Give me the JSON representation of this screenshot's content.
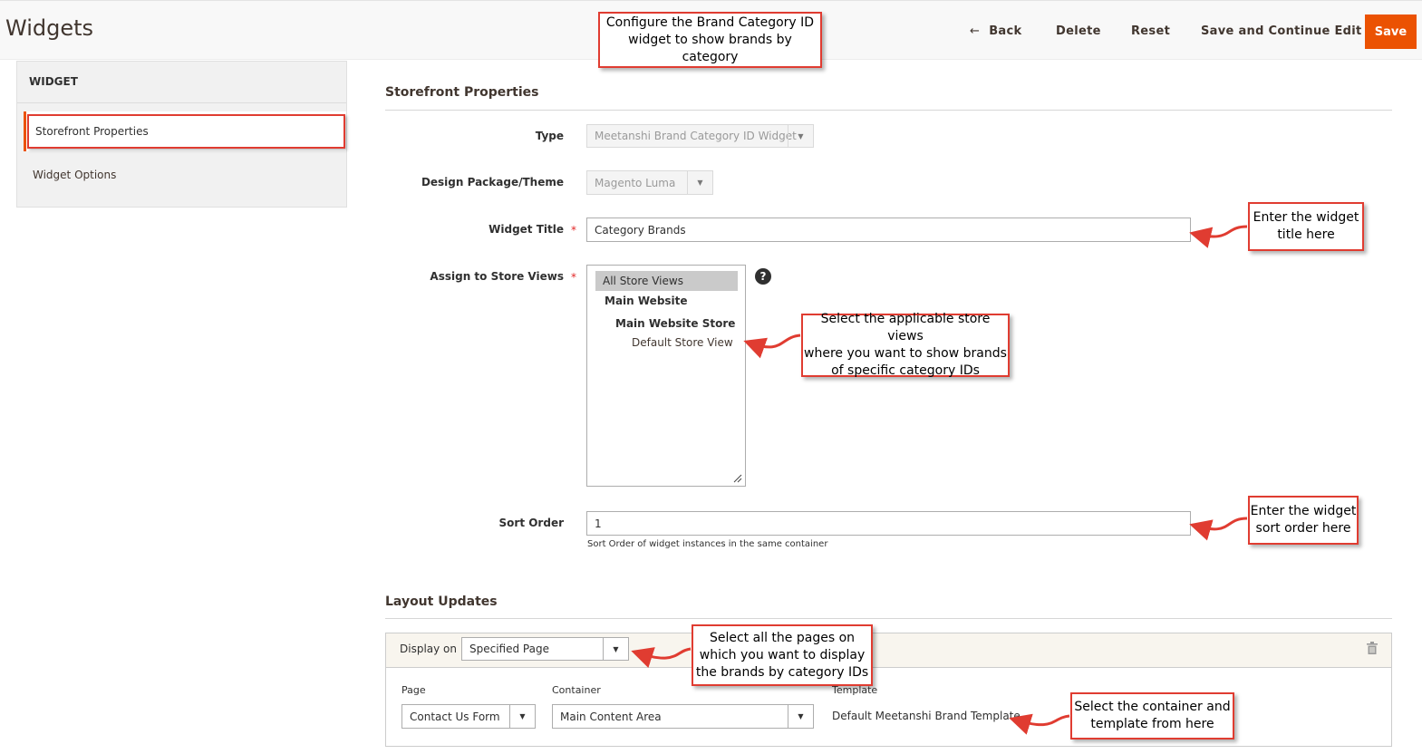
{
  "header": {
    "title": "Widgets",
    "back_label": "Back",
    "delete_label": "Delete",
    "reset_label": "Reset",
    "save_continue_label": "Save and Continue Edit",
    "save_label": "Save"
  },
  "sidebar": {
    "title": "WIDGET",
    "items": [
      {
        "label": "Storefront Properties",
        "active": true
      },
      {
        "label": "Widget Options",
        "active": false
      }
    ]
  },
  "storefront": {
    "section_title": "Storefront Properties",
    "type": {
      "label": "Type",
      "value": "Meetanshi Brand Category ID Widget"
    },
    "theme": {
      "label": "Design Package/Theme",
      "value": "Magento Luma"
    },
    "widget_title": {
      "label": "Widget Title",
      "required_mark": "*",
      "value": "Category Brands"
    },
    "store_views": {
      "label": "Assign to Store Views",
      "required_mark": "*",
      "options": [
        "All Store Views",
        "Main Website",
        "Main Website Store",
        "Default Store View"
      ],
      "selected": "All Store Views",
      "help_glyph": "?"
    },
    "sort_order": {
      "label": "Sort Order",
      "value": "1",
      "note": "Sort Order of widget instances in the same container"
    }
  },
  "layout_updates": {
    "section_title": "Layout Updates",
    "display_on_label": "Display on",
    "display_on_value": "Specified Page",
    "page_label": "Page",
    "page_value": "Contact Us Form",
    "container_label": "Container",
    "container_value": "Main Content Area",
    "template_label": "Template",
    "template_value": "Default Meetanshi Brand Template"
  },
  "annotations": {
    "top": [
      "Configure the Brand Category ID",
      "widget to show brands by category"
    ],
    "title": [
      "Enter the widget",
      "title here"
    ],
    "stores": [
      "Select the applicable store views",
      "where you want to show brands",
      "of specific category IDs"
    ],
    "sort": [
      "Enter the widget",
      "sort order here"
    ],
    "pages": [
      "Select all the pages on",
      "which you want to display",
      "the brands by category IDs"
    ],
    "container": [
      "Select the container and",
      "template from here"
    ]
  },
  "colors": {
    "accent": "#eb5202",
    "annotation": "#e03c31"
  },
  "icons": [
    "back-arrow-icon",
    "dropdown-arrow-icon",
    "help-icon",
    "trash-icon",
    "resize-grip-icon"
  ]
}
